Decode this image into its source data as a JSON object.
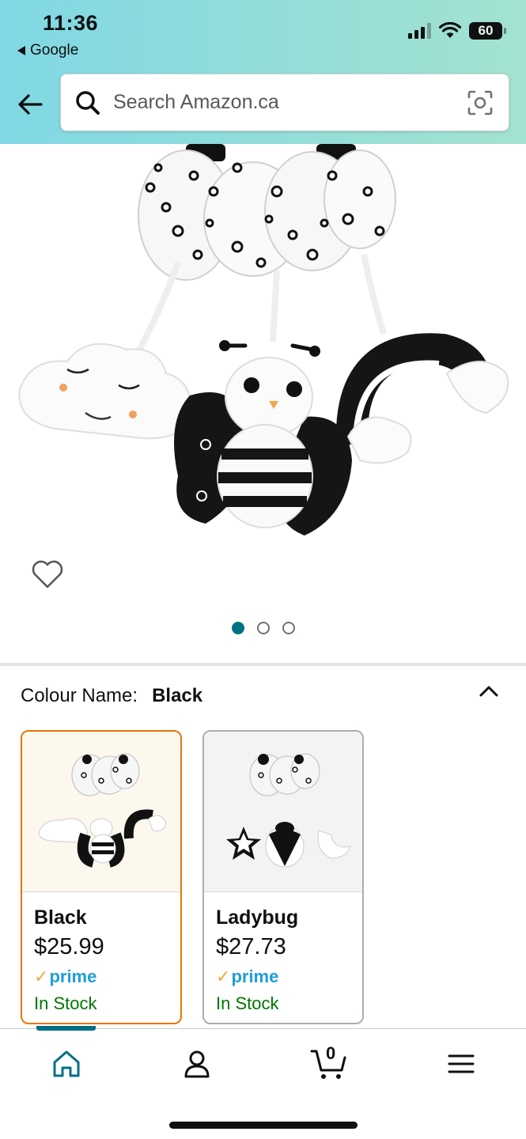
{
  "status_bar": {
    "time": "11:36",
    "back_app": "Google",
    "battery": "60"
  },
  "search": {
    "placeholder": "Search Amazon.ca"
  },
  "product": {
    "image_count": 3,
    "active_image": 1,
    "colour_label": "Colour Name:",
    "colour_value": "Black"
  },
  "variants": [
    {
      "name": "Black",
      "price": "$25.99",
      "prime": "prime",
      "stock": "In Stock",
      "selected": true
    },
    {
      "name": "Ladybug",
      "price": "$27.73",
      "prime": "prime",
      "stock": "In Stock",
      "selected": false
    }
  ],
  "bottom_nav": {
    "cart_count": "0",
    "active": "home",
    "items": [
      "home-icon",
      "account-icon",
      "cart-icon",
      "menu-icon"
    ]
  },
  "colors": {
    "accent": "#007185",
    "selected_border": "#e77600",
    "in_stock": "#007600",
    "prime": "#1f9eda"
  }
}
